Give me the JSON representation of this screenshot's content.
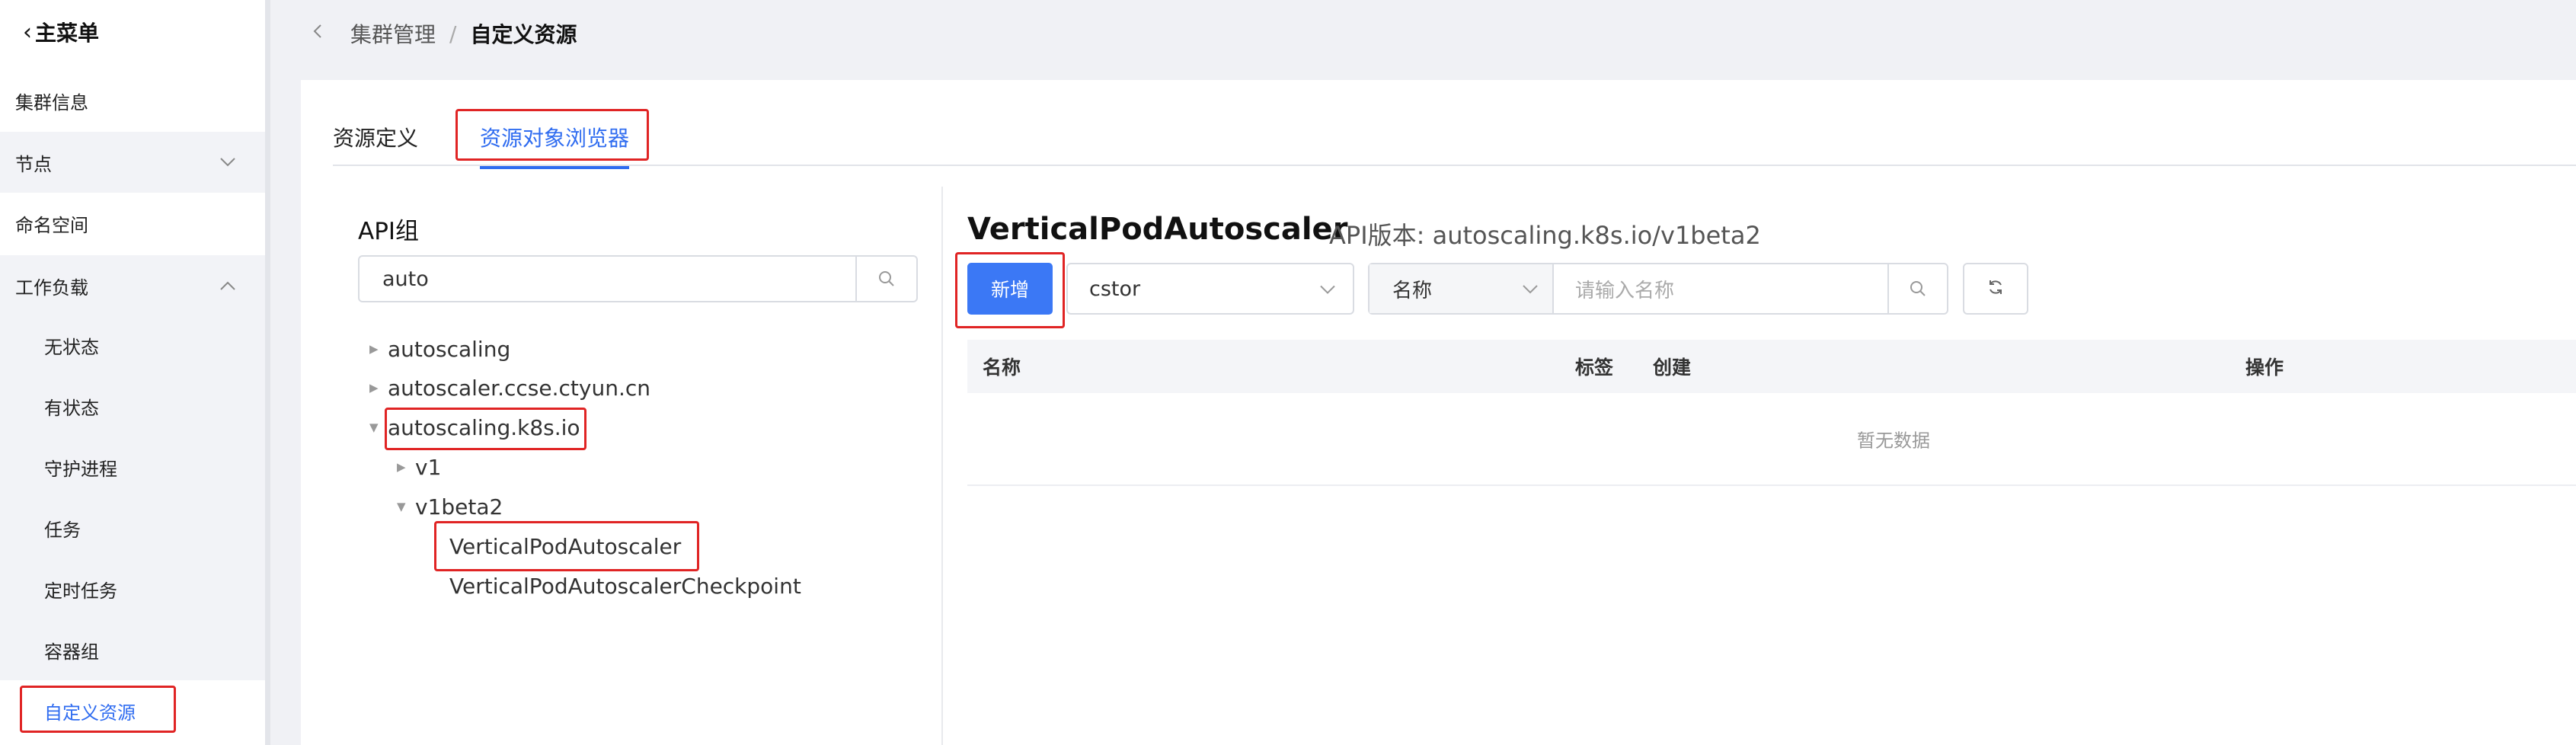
{
  "sidebar": {
    "back_label": "主菜单",
    "items": [
      {
        "label": "集群信息"
      },
      {
        "label": "节点"
      },
      {
        "label": "命名空间"
      },
      {
        "label": "工作负载"
      }
    ],
    "workload_children": [
      {
        "label": "无状态"
      },
      {
        "label": "有状态"
      },
      {
        "label": "守护进程"
      },
      {
        "label": "任务"
      },
      {
        "label": "定时任务"
      },
      {
        "label": "容器组"
      },
      {
        "label": "自定义资源"
      }
    ],
    "active_item": "自定义资源"
  },
  "breadcrumb": {
    "parent": "集群管理",
    "separator": "/",
    "current": "自定义资源"
  },
  "tabs": [
    {
      "label": "资源定义"
    },
    {
      "label": "资源对象浏览器",
      "active": true
    }
  ],
  "api_group": {
    "title": "API组",
    "search_value": "auto",
    "tree": [
      {
        "label": "autoscaling",
        "expanded": false
      },
      {
        "label": "autoscaler.ccse.ctyun.cn",
        "expanded": false
      },
      {
        "label": "autoscaling.k8s.io",
        "expanded": true
      },
      {
        "label": "v1",
        "expanded": false
      },
      {
        "label": "v1beta2",
        "expanded": true
      },
      {
        "label": "VerticalPodAutoscaler",
        "selected": true
      },
      {
        "label": "VerticalPodAutoscalerCheckpoint"
      }
    ]
  },
  "resource": {
    "title": "VerticalPodAutoscaler",
    "api_version": "API版本: autoscaling.k8s.io/v1beta2",
    "add_button": "新增",
    "namespace_value": "cstor",
    "filter_key": "名称",
    "filter_placeholder": "请输入名称",
    "columns": [
      "名称",
      "标签",
      "创建",
      "操作"
    ],
    "empty_text": "暂无数据"
  },
  "colors": {
    "accent": "#2f6cf0",
    "highlight_box": "#e02424",
    "primary_button": "#3b78f5"
  }
}
